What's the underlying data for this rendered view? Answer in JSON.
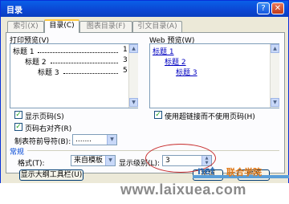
{
  "window": {
    "title": "目录",
    "help_glyph": "?",
    "close_glyph": "✕"
  },
  "tabs": [
    {
      "label": "索引(X)",
      "active": false
    },
    {
      "label": "目录(C)",
      "active": true
    },
    {
      "label": "图表目录(F)",
      "active": false
    },
    {
      "label": "引文目录(A)",
      "active": false
    }
  ],
  "print_preview": {
    "label": "打印预览(V)",
    "entries": [
      {
        "text": "标题 1",
        "page": "1"
      },
      {
        "text": "标题 2",
        "page": "3"
      },
      {
        "text": "标题 3",
        "page": "5"
      }
    ]
  },
  "web_preview": {
    "label": "Web 预览(W)",
    "entries": [
      "标题 1",
      "标题 2",
      "标题 3"
    ]
  },
  "options": {
    "show_page_numbers": {
      "label": "显示页码(S)",
      "checked": true
    },
    "right_align": {
      "label": "页码右对齐(R)",
      "checked": true
    },
    "tab_leader_label": "制表符前导符(B):",
    "tab_leader_value": ".......",
    "hyperlinks": {
      "label": "使用超链接而不使用页码(H)",
      "checked": true
    }
  },
  "general": {
    "group_label": "常规",
    "format_label": "格式(T):",
    "format_value": "来自模板",
    "levels_label": "显示级别(L):",
    "levels_value": "3",
    "outline_button": "显示大纲工具栏(U)",
    "options_button": "选项",
    "modify_button": "修改"
  },
  "watermark": {
    "url": "www.laixuea.com",
    "logo": "net",
    "school": "联合学院"
  }
}
